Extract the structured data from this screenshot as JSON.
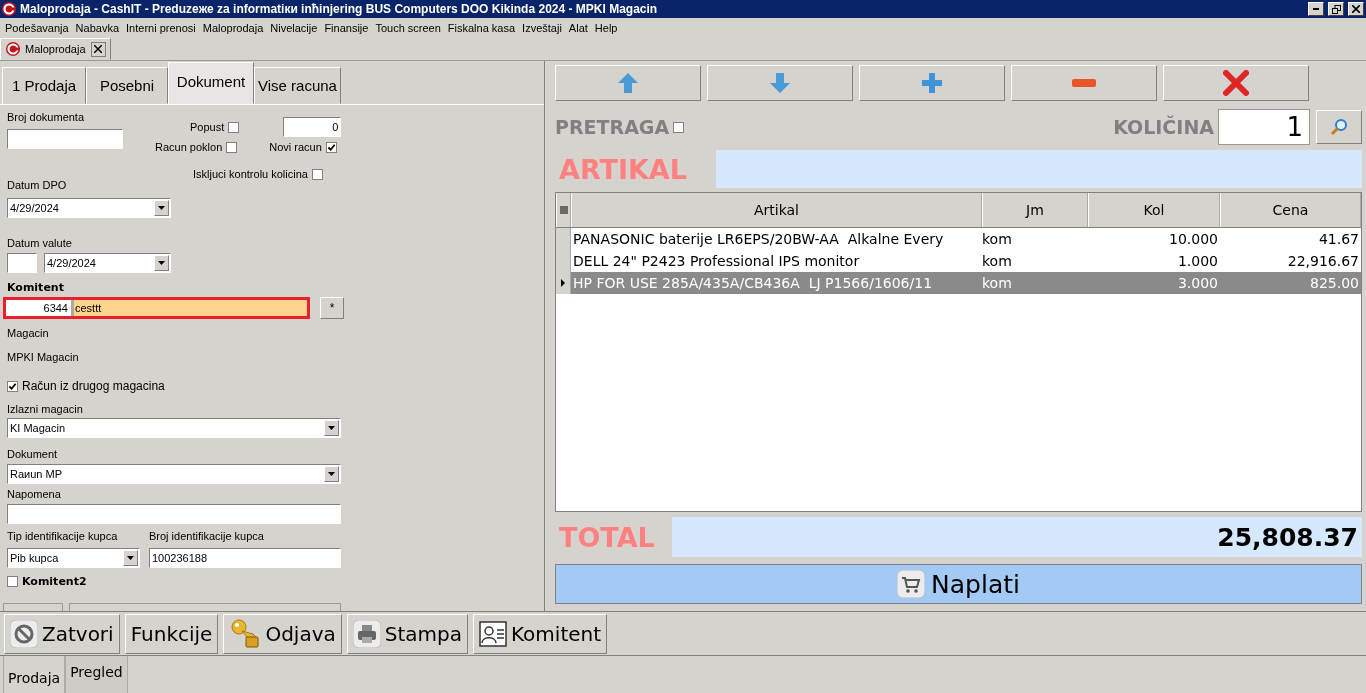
{
  "window": {
    "title": "Maloprodaja - CashIT - Preduzeже za informatiки inћinjering BUS Computers DOO Kikinda 2024 - MPKI Magacin"
  },
  "menu": [
    "Podešavanja",
    "Nabavka",
    "Interni prenosi",
    "Maloprodaja",
    "Nivelacije",
    "Finansije",
    "Touch screen",
    "Fiskalna kasa",
    "Izveštaji",
    "Alat",
    "Help"
  ],
  "doc_tabs": [
    {
      "label": "Maloprodaja",
      "selected": true
    }
  ],
  "left_tabs": [
    {
      "label": "1 Prodaja",
      "selected": false
    },
    {
      "label": "Posebni",
      "selected": false
    },
    {
      "label": "Dokument",
      "selected": true
    },
    {
      "label": "Vise racuna",
      "selected": false
    }
  ],
  "form": {
    "broj_dokumenta": {
      "label": "Broj dokumenta"
    },
    "popust": {
      "label": "Popust",
      "checked": false,
      "value": "0"
    },
    "racun_poklon": {
      "label": "Racun poklon",
      "checked": false
    },
    "novi_racun": {
      "label": "Novi racun",
      "checked": true
    },
    "iskljuci_kontrolu": {
      "label": "Iskljuci kontrolu kolicina",
      "checked": false
    },
    "datum_dpo": {
      "label": "Datum DPO",
      "value": "4/29/2024"
    },
    "datum_valute": {
      "label": "Datum valute",
      "value": "4/29/2024"
    },
    "komitent": {
      "label": "Komitent",
      "code": "6344",
      "name": "cesttt",
      "button": "*"
    },
    "magacin": {
      "label": "Magacin",
      "value": "MPKI Magacin"
    },
    "racun_iz_drugog": {
      "label": "Račun iz drugog magacina",
      "checked": true
    },
    "izlazni_magacin": {
      "label": "Izlazni magacin",
      "value": "KI Magacin"
    },
    "dokument": {
      "label": "Dokument",
      "value": "Raиun MP"
    },
    "napomena": {
      "label": "Napomena"
    },
    "tip_identifikacije": {
      "label": "Tip identifikacije kupca",
      "value": "Pib kupca"
    },
    "broj_identifikacije": {
      "label": "Broj identifikacije kupca",
      "value": "100236188"
    },
    "komitent2": {
      "label": "Komitent2",
      "checked": false
    }
  },
  "toolbar": [
    {
      "kind": "up"
    },
    {
      "kind": "down"
    },
    {
      "kind": "add"
    },
    {
      "kind": "remove"
    },
    {
      "kind": "delete"
    }
  ],
  "search": {
    "label": "PRETRAGA",
    "checked": false
  },
  "quantity": {
    "label": "KOLIČINA",
    "value": "1"
  },
  "article": {
    "label": "ARTIKAL"
  },
  "table": {
    "columns": [
      "Artikal",
      "Jm",
      "Kol",
      "Cena"
    ],
    "rows": [
      {
        "cells": [
          "PANASONIC baterije LR6EPS/20BW-AA  Alkalne Every",
          "kom",
          "10.000",
          "41.67"
        ],
        "selected": false
      },
      {
        "cells": [
          "DELL 24\" P2423 Professional IPS monitor",
          "kom",
          "1.000",
          "22,916.67"
        ],
        "selected": false
      },
      {
        "cells": [
          "HP FOR USE 285A/435A/CB436A  LJ P1566/1606/11",
          "kom",
          "3.000",
          "825.00"
        ],
        "selected": true
      }
    ]
  },
  "total": {
    "label": "TOTAL",
    "value": "25,808.37"
  },
  "pay_button": {
    "label": "Naplati"
  },
  "bottom_buttons": [
    {
      "label": "Zatvori",
      "kind": "close"
    },
    {
      "label": "Funkcije",
      "kind": "plain"
    },
    {
      "label": "Odjava",
      "kind": "key"
    },
    {
      "label": "Stampa",
      "kind": "print"
    },
    {
      "label": "Komitent",
      "kind": "contact"
    }
  ],
  "bottom_tabs": [
    {
      "label": "Prodaja",
      "selected": true
    },
    {
      "label": "Pregled",
      "selected": false
    }
  ]
}
